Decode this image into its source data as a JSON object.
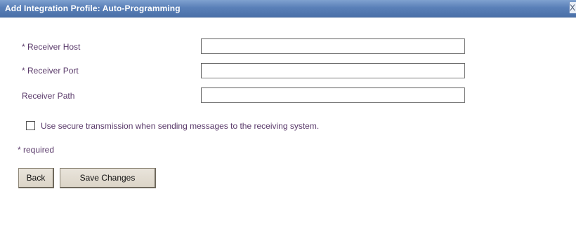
{
  "dialog": {
    "title": "Add Integration Profile: Auto-Programming",
    "close_label": "X"
  },
  "form": {
    "fields": [
      {
        "label": "* Receiver Host",
        "value": "",
        "placeholder": ""
      },
      {
        "label": "* Receiver Port",
        "value": "",
        "placeholder": ""
      },
      {
        "label": "Receiver Path",
        "value": "",
        "placeholder": ""
      }
    ],
    "secure_transmission": {
      "label": "Use secure transmission when sending messages to the receiving system.",
      "checked": false
    },
    "required_note": "* required"
  },
  "buttons": {
    "back_label": "Back",
    "save_label": "Save Changes"
  },
  "colors": {
    "titlebar": "#5a80b8",
    "label_text": "#5a3a6a",
    "button_face": "#dcd5c8"
  }
}
